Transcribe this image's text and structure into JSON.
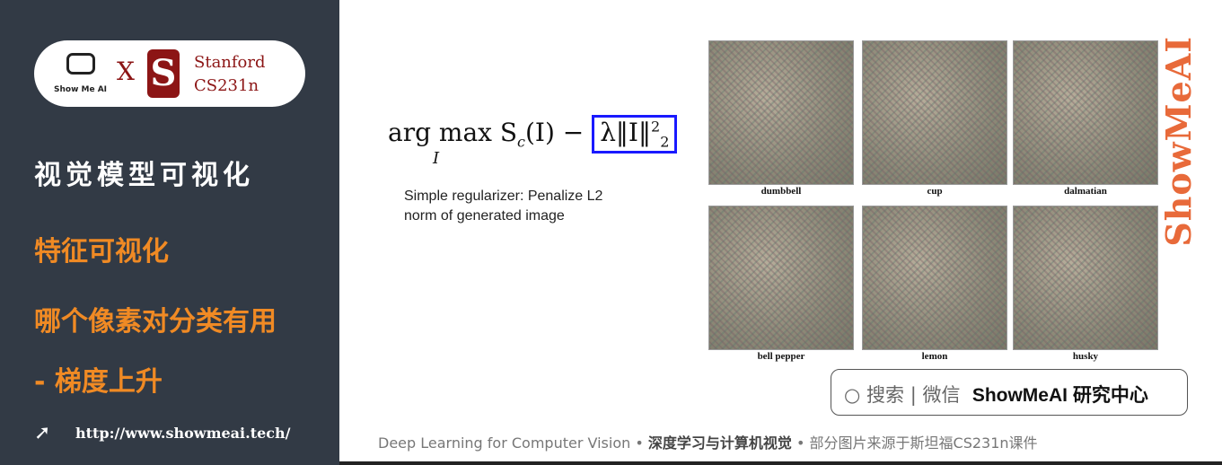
{
  "logo": {
    "showmeai": "Show Me AI",
    "x": "X",
    "stanford": "Stanford",
    "course": "CS231n"
  },
  "sidebar": {
    "title": "视觉模型可视化",
    "topic1": "特征可视化",
    "topic2": "哪个像素对分类有用",
    "topic3": "- 梯度上升",
    "url": "http://www.showmeai.tech/"
  },
  "formula": {
    "main": "arg max S",
    "sub_c": "c",
    "arg": "(I) −",
    "sub_I": "I",
    "reg": "λ‖I‖",
    "exp": "2",
    "low": "2"
  },
  "regularizer": {
    "line1": "Simple regularizer: Penalize L2",
    "line2": "norm of generated image"
  },
  "images": [
    {
      "label": "dumbbell"
    },
    {
      "label": "cup"
    },
    {
      "label": "dalmatian"
    },
    {
      "label": "bell pepper"
    },
    {
      "label": "lemon"
    },
    {
      "label": "husky"
    }
  ],
  "watermark": "ShowMeAI",
  "search": {
    "icon": "search-icon",
    "prefix": "搜索 | 微信",
    "name": "ShowMeAI 研究中心"
  },
  "footer": {
    "en": "Deep Learning for Computer Vision",
    "sep": "•",
    "cn": "深度学习与计算机视觉",
    "note": "部分图片来源于斯坦福CS231n课件"
  },
  "colors": {
    "sidebar": "#323a45",
    "accent": "#f08a24",
    "stanford": "#8c1515",
    "box": "#1a1aff"
  }
}
